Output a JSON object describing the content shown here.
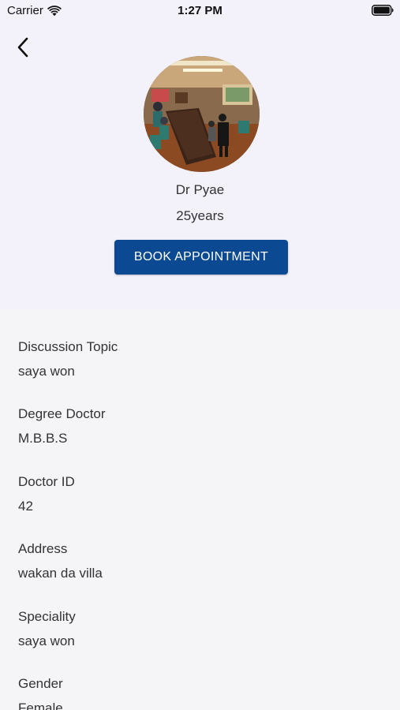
{
  "status_bar": {
    "carrier": "Carrier",
    "time": "1:27 PM",
    "wifi_icon": "wifi-icon",
    "battery_icon": "battery-icon"
  },
  "header": {
    "back_icon": "chevron-left-icon"
  },
  "profile": {
    "name": "Dr Pyae",
    "experience": "25years",
    "book_label": "BOOK APPOINTMENT",
    "button_color": "#0b4a92"
  },
  "details": [
    {
      "label": "Discussion Topic",
      "value": "saya won"
    },
    {
      "label": "Degree Doctor",
      "value": "M.B.B.S"
    },
    {
      "label": "Doctor ID",
      "value": "42"
    },
    {
      "label": "Address",
      "value": "wakan da villa"
    },
    {
      "label": "Speciality",
      "value": "saya won"
    },
    {
      "label": "Gender",
      "value": "Female"
    }
  ]
}
